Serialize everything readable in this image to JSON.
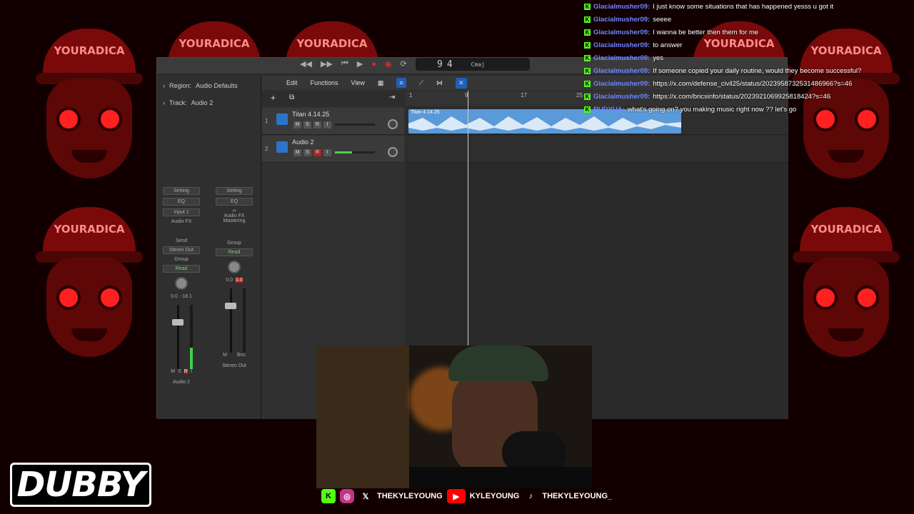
{
  "background": {
    "mascot_text": "YOURADICA",
    "accent_color": "#ff2020"
  },
  "daw": {
    "lcd": {
      "bar": "9",
      "beat": "4",
      "key": "Cmaj"
    },
    "inspector": {
      "region_prefix": "Region:",
      "region_name": "Audio Defaults",
      "track_prefix": "Track:",
      "track_name": "Audio 2"
    },
    "toolbar": {
      "edit": "Edit",
      "functions": "Functions",
      "view": "View"
    },
    "ruler": [
      "1",
      "9",
      "17",
      "25"
    ],
    "tracks": [
      {
        "num": "1",
        "name": "Titan 4.14.25",
        "m": "M",
        "s": "S",
        "r": "R",
        "i": "I"
      },
      {
        "num": "2",
        "name": "Audio 2",
        "m": "M",
        "s": "S",
        "r": "R",
        "i": "I"
      }
    ],
    "region_label": "Titan 4.14.25",
    "strips": [
      {
        "setting": "Setting",
        "eq": "EQ",
        "input": "Input 1",
        "audiofx": "Audio FX",
        "send": "Send",
        "output": "Stereo Out",
        "group": "Group",
        "read": "Read",
        "vol": "0.0",
        "peak": "-18.1",
        "m": "M",
        "s": "S",
        "r": "R",
        "i": "I",
        "name": "Audio 2"
      },
      {
        "setting": "Setting",
        "eq": "EQ",
        "audiofx": "Audio FX",
        "mastering": "Mastering",
        "group": "Group",
        "read": "Read",
        "vol": "0.0",
        "peak": "0.0",
        "m": "M",
        "bnc": "Bnc",
        "name": "Stereo Out"
      }
    ]
  },
  "chat": [
    {
      "user": "Glacialmusher09:",
      "msg": "I just know some situations that has happened yesss u got it"
    },
    {
      "user": "Glacialmusher09:",
      "msg": "seeee"
    },
    {
      "user": "Glacialmusher09:",
      "msg": "I wanna be better then them for me"
    },
    {
      "user": "Glacialmusher09:",
      "msg": "to answer"
    },
    {
      "user": "Glacialmusher09:",
      "msg": "yes"
    },
    {
      "user": "Glacialmusher09:",
      "msg": "If someone copied your daily routine, would they become successful?"
    },
    {
      "user": "Glacialmusher09:",
      "msg": "https://x.com/defense_civil25/status/2023958732531486966?s=46"
    },
    {
      "user": "Glacialmusher09:",
      "msg": "https://x.com/bricsinfo/status/2023921069925818424?s=46"
    },
    {
      "user": "RUDYUA:",
      "msg": "what's going on? you making music right now ?? let's go"
    }
  ],
  "socials": {
    "kick_label": "K",
    "x_handle": "THEKYLEYOUNG",
    "youtube_handle": "KYLEYOUNG",
    "tiktok_handle": "THEKYLEYOUNG_"
  },
  "logo": "DUBBY"
}
